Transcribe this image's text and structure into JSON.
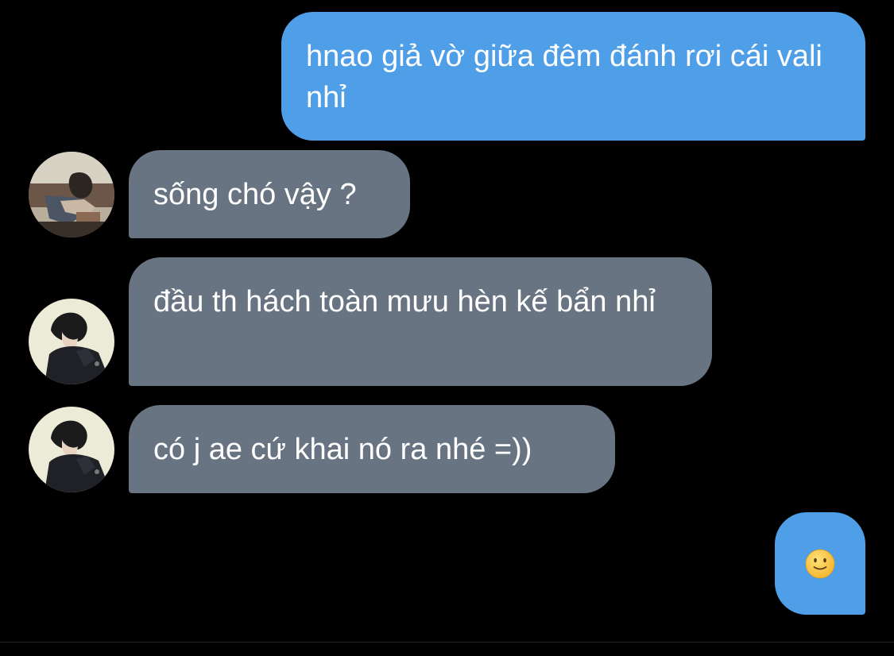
{
  "messages": [
    {
      "id": "m1",
      "direction": "outgoing",
      "text": "hnao giả vờ giữa đêm đánh rơi cái vali nhỉ"
    },
    {
      "id": "m2",
      "direction": "incoming",
      "sender_avatar": "avatar-user-1",
      "text": "sống chó vậy ?"
    },
    {
      "id": "m3",
      "direction": "incoming",
      "sender_avatar": "avatar-user-2",
      "text": "đầu th hách toàn mưu hèn kế bẩn nhỉ"
    },
    {
      "id": "m4",
      "direction": "incoming",
      "sender_avatar": "avatar-user-2",
      "text": "có j ae cứ khai nó ra nhé =))"
    },
    {
      "id": "m5",
      "direction": "outgoing",
      "emoji": "slightly-smiling-face-icon"
    }
  ],
  "colors": {
    "background": "#000000",
    "outgoing_bubble": "#4f9ee8",
    "incoming_bubble": "#687482",
    "text": "#ffffff"
  }
}
